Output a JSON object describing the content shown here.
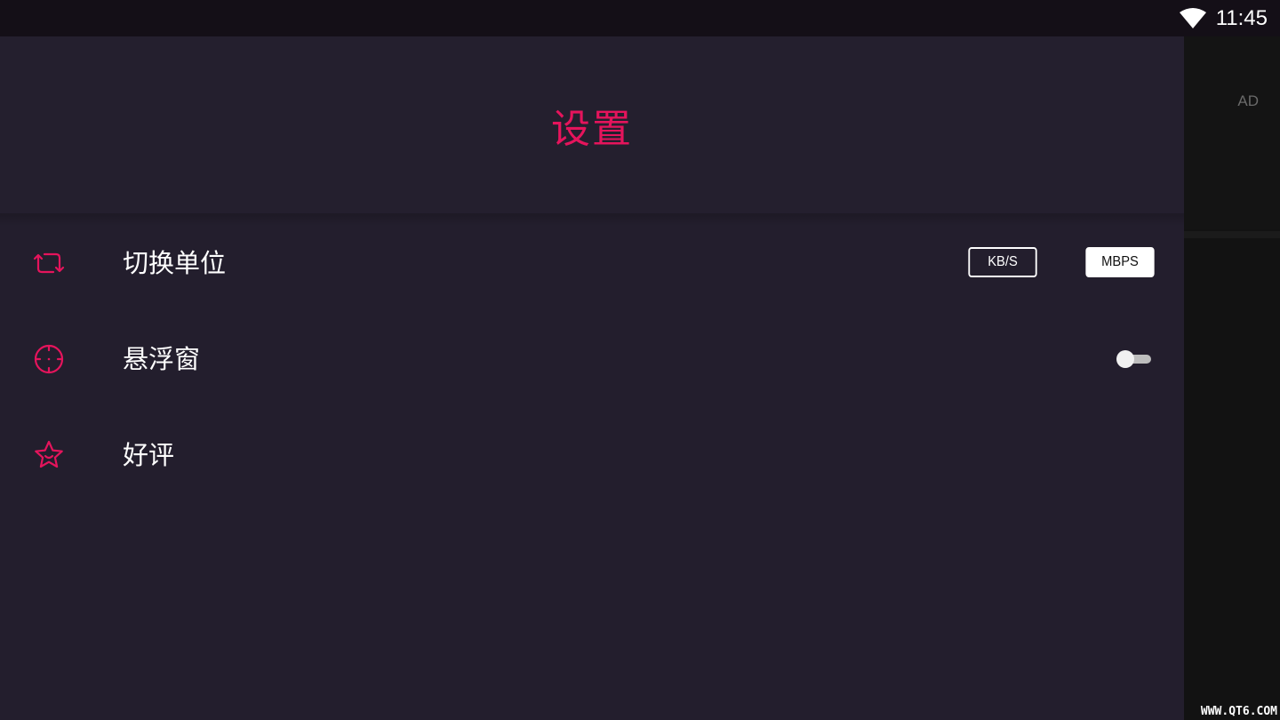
{
  "status_bar": {
    "time": "11:45",
    "wifi_icon": "wifi-icon"
  },
  "page": {
    "title": "设置",
    "accent_color": "#e5145c",
    "background_color": "#231e2d"
  },
  "settings": {
    "switch_unit": {
      "label": "切换单位",
      "icon": "swap-cycle-icon",
      "options": [
        "KB/S",
        "MBPS"
      ],
      "selected": "MBPS"
    },
    "floating_window": {
      "label": "悬浮窗",
      "icon": "crosshair-icon",
      "enabled": false
    },
    "rating": {
      "label": "好评",
      "icon": "star-icon"
    }
  },
  "ad_panel": {
    "label": "AD"
  },
  "watermark": "WWW.QT6.COM"
}
